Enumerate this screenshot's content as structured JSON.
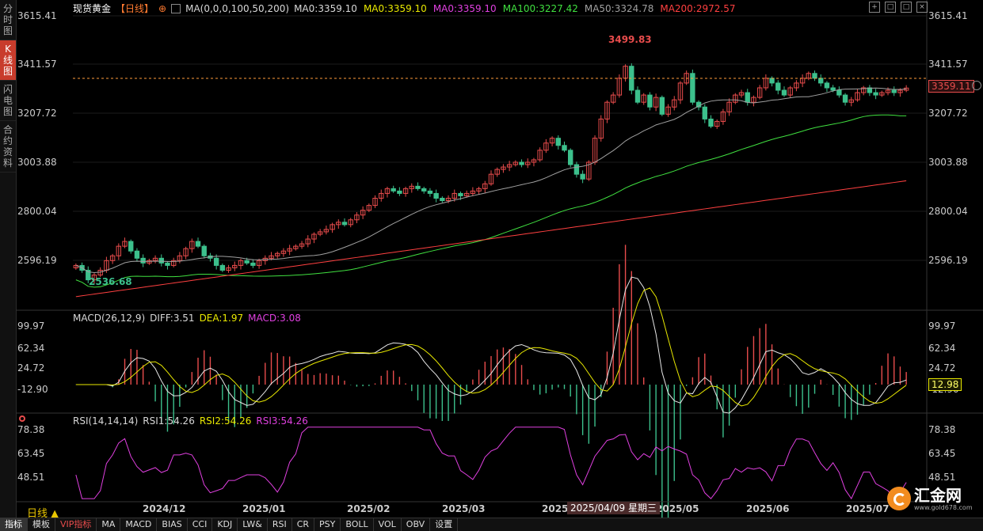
{
  "sidebar": {
    "tabs": [
      {
        "label": "分时图",
        "active": false
      },
      {
        "label": "K线图",
        "active": true
      },
      {
        "label": "闪电图",
        "active": false
      },
      {
        "label": "合约资料",
        "active": false
      }
    ]
  },
  "header": {
    "instrument": "现货黄金",
    "period_tag": "【日线】",
    "ma_params": "MA(0,0,0,100,50,200)",
    "ma_values": [
      {
        "text": "MA0:3359.10",
        "color": "#d8d8d8"
      },
      {
        "text": "MA0:3359.10",
        "color": "#e8e800"
      },
      {
        "text": "MA0:3359.10",
        "color": "#e040e0"
      },
      {
        "text": "MA100:3227.42",
        "color": "#40e040"
      },
      {
        "text": "MA50:3324.78",
        "color": "#a0a0a0"
      },
      {
        "text": "MA200:2972.57",
        "color": "#ff4040"
      }
    ]
  },
  "price_axis": {
    "labels": [
      "3615.41",
      "3411.57",
      "3207.72",
      "3003.88",
      "2800.04",
      "2596.19"
    ]
  },
  "current_price": "3359.11",
  "annotations": {
    "high": "3499.83",
    "low": "2536.68"
  },
  "macd": {
    "header": "MACD(26,12,9)",
    "diff": "DIFF:3.51",
    "dea": "DEA:1.97",
    "macd": "MACD:3.08",
    "axis": [
      "99.97",
      "62.34",
      "24.72",
      "-12.90"
    ],
    "tag": "12.98"
  },
  "rsi": {
    "header": "RSI(14,14,14)",
    "rsi1": "RSI1:54.26",
    "rsi2": "RSI2:54.26",
    "rsi3": "RSI3:54.26",
    "axis": [
      "78.38",
      "63.45",
      "48.51"
    ]
  },
  "time_axis": [
    "2024/12",
    "2025/01",
    "2025/02",
    "2025/03",
    "2025/",
    "2025/05",
    "2025/06",
    "2025/07"
  ],
  "crosshair_date": "2025/04/09 星期三",
  "period_label": "日线",
  "bottom_tabs": [
    {
      "label": "指标",
      "style": "active"
    },
    {
      "label": "模板",
      "style": ""
    },
    {
      "label": "VIP指标",
      "style": "vip"
    },
    {
      "label": "MA",
      "style": ""
    },
    {
      "label": "MACD",
      "style": ""
    },
    {
      "label": "BIAS",
      "style": ""
    },
    {
      "label": "CCI",
      "style": ""
    },
    {
      "label": "KDJ",
      "style": ""
    },
    {
      "label": "LW&",
      "style": ""
    },
    {
      "label": "RSI",
      "style": ""
    },
    {
      "label": "CR",
      "style": ""
    },
    {
      "label": "PSY",
      "style": ""
    },
    {
      "label": "BOLL",
      "style": ""
    },
    {
      "label": "VOL",
      "style": ""
    },
    {
      "label": "OBV",
      "style": ""
    },
    {
      "label": "设置",
      "style": ""
    }
  ],
  "logo": {
    "text": "汇金网",
    "url": "www.gold678.com"
  },
  "chart_data": {
    "type": "candlestick",
    "price_range": [
      2440,
      3660
    ],
    "candles_close_approx": [
      2620,
      2600,
      2560,
      2580,
      2600,
      2640,
      2660,
      2700,
      2720,
      2680,
      2650,
      2630,
      2640,
      2650,
      2630,
      2620,
      2640,
      2660,
      2690,
      2720,
      2700,
      2660,
      2650,
      2620,
      2600,
      2610,
      2620,
      2640,
      2630,
      2620,
      2640,
      2650,
      2660,
      2670,
      2680,
      2690,
      2700,
      2710,
      2730,
      2750,
      2760,
      2770,
      2790,
      2800,
      2790,
      2810,
      2830,
      2850,
      2870,
      2900,
      2920,
      2940,
      2930,
      2920,
      2940,
      2950,
      2940,
      2930,
      2920,
      2900,
      2890,
      2900,
      2920,
      2910,
      2920,
      2930,
      2940,
      2960,
      3000,
      3020,
      3030,
      3040,
      3050,
      3040,
      3050,
      3060,
      3100,
      3130,
      3150,
      3120,
      3100,
      3040,
      3000,
      2980,
      3050,
      3150,
      3230,
      3300,
      3330,
      3400,
      3450,
      3350,
      3300,
      3330,
      3280,
      3320,
      3250,
      3280,
      3310,
      3380,
      3420,
      3300,
      3280,
      3230,
      3200,
      3220,
      3260,
      3300,
      3330,
      3340,
      3300,
      3320,
      3360,
      3400,
      3380,
      3350,
      3330,
      3360,
      3380,
      3400,
      3420,
      3400,
      3380,
      3360,
      3350,
      3330,
      3300,
      3310,
      3340,
      3360,
      3340,
      3330,
      3340,
      3350,
      3340,
      3350,
      3359
    ]
  }
}
